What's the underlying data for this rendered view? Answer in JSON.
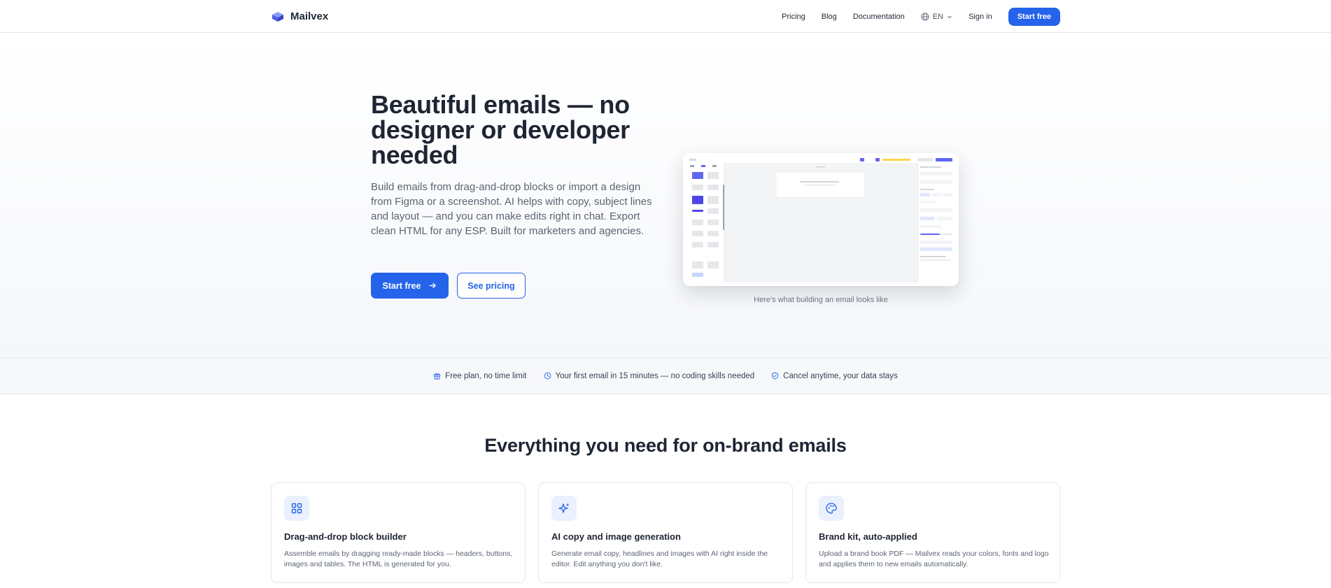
{
  "brand": {
    "name": "Mailvex"
  },
  "nav": {
    "links": [
      "Pricing",
      "Blog",
      "Documentation"
    ],
    "language": "EN",
    "sign_in": "Sign in",
    "cta": "Start free"
  },
  "hero": {
    "title": "Beautiful emails — no designer or developer needed",
    "description": "Build emails from drag-and-drop blocks or import a design from Figma or a screenshot. AI helps with copy, subject lines and layout — and you can make edits right in chat. Export clean HTML for any ESP. Built for marketers and agencies.",
    "primary_button": "Start free",
    "secondary_button": "See pricing",
    "screenshot_caption": "Here's what building an email looks like"
  },
  "trust": [
    {
      "icon": "gift-icon",
      "text": "Free plan, no time limit"
    },
    {
      "icon": "clock-icon",
      "text": "Your first email in 15 minutes — no coding skills needed"
    },
    {
      "icon": "shield-check-icon",
      "text": "Cancel anytime, your data stays"
    }
  ],
  "features": {
    "title": "Everything you need for on-brand emails",
    "cards": [
      {
        "icon": "grid-icon",
        "title": "Drag-and-drop block builder",
        "description": "Assemble emails by dragging ready-made blocks — headers, buttons, images and tables. The HTML is generated for you."
      },
      {
        "icon": "sparkles-icon",
        "title": "AI copy and image generation",
        "description": "Generate email copy, headlines and images with AI right inside the editor. Edit anything you don't like."
      },
      {
        "icon": "palette-icon",
        "title": "Brand kit, auto-applied",
        "description": "Upload a brand book PDF — Mailvex reads your colors, fonts and logo and applies them to new emails automatically."
      }
    ]
  },
  "colors": {
    "accent": "#2563eb",
    "heading": "#1e2533",
    "muted": "#5b6472"
  }
}
